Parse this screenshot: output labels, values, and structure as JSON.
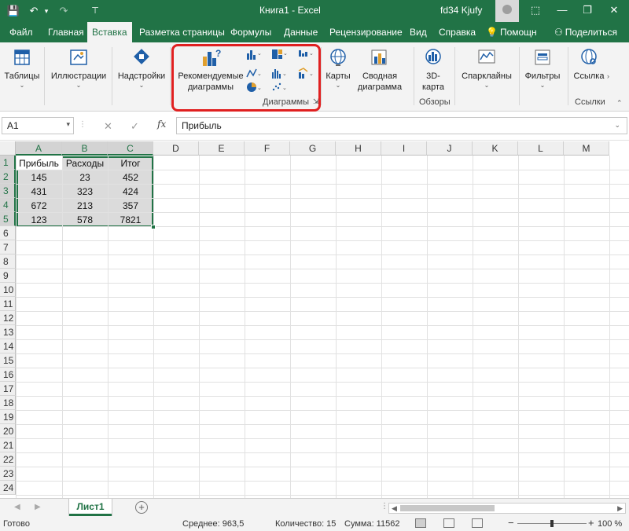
{
  "titlebar": {
    "title": "Книга1  -  Excel",
    "user": "fd34 Kjufy",
    "minimize": "—",
    "restore": "❐",
    "close": "✕",
    "qa_save": "💾",
    "qa_undo": "↶",
    "qa_dropdown": "▾",
    "qa_redo": "↷",
    "qa_custom": "⊤"
  },
  "menu": {
    "tabs": [
      "Файл",
      "Главная",
      "Вставка",
      "Разметка страницы",
      "Формулы",
      "Данные",
      "Рецензирование",
      "Вид",
      "Справка"
    ],
    "help_label": "Помощн",
    "share_label": "Поделиться"
  },
  "ribbon": {
    "tables": "Таблицы",
    "illustrations": "Иллюстрации",
    "addins": "Надстройки",
    "recommended_line1": "Рекомендуемые",
    "recommended_line2": "диаграммы",
    "charts_group": "Диаграммы",
    "maps": "Карты",
    "pivot_line1": "Сводная",
    "pivot_line2": "диаграмма",
    "map3d_line1": "3D-",
    "map3d_line2": "карта",
    "tours_group": "Обзоры",
    "sparklines": "Спарклайны",
    "filters": "Фильтры",
    "links": "Ссылка",
    "links_group": "Ссылки"
  },
  "formulabar": {
    "name_box": "A1",
    "cancel": "✕",
    "enter": "✓",
    "fx": "fx",
    "formula": "Прибыль"
  },
  "grid": {
    "columns": [
      "A",
      "B",
      "C",
      "D",
      "E",
      "F",
      "G",
      "H",
      "I",
      "J",
      "K",
      "L",
      "M"
    ],
    "rows": [
      "1",
      "2",
      "3",
      "4",
      "5",
      "6",
      "7",
      "8",
      "9",
      "10",
      "11",
      "12",
      "13",
      "14",
      "15",
      "16",
      "17",
      "18",
      "19",
      "20",
      "21",
      "22",
      "23",
      "24"
    ],
    "data": [
      [
        "Прибыль",
        "Расходы",
        "Итог"
      ],
      [
        "145",
        "23",
        "452"
      ],
      [
        "431",
        "323",
        "424"
      ],
      [
        "672",
        "213",
        "357"
      ],
      [
        "123",
        "578",
        "7821"
      ]
    ]
  },
  "sheets": {
    "active": "Лист1",
    "add": "+"
  },
  "status": {
    "ready": "Готово",
    "average": "Среднее: 963,5",
    "count": "Количество: 15",
    "sum": "Сумма: 11562",
    "zoom": "100 %",
    "zoom_minus": "−",
    "zoom_plus": "+"
  },
  "colors": {
    "excel_green": "#217346",
    "highlight_red": "#e02020"
  }
}
